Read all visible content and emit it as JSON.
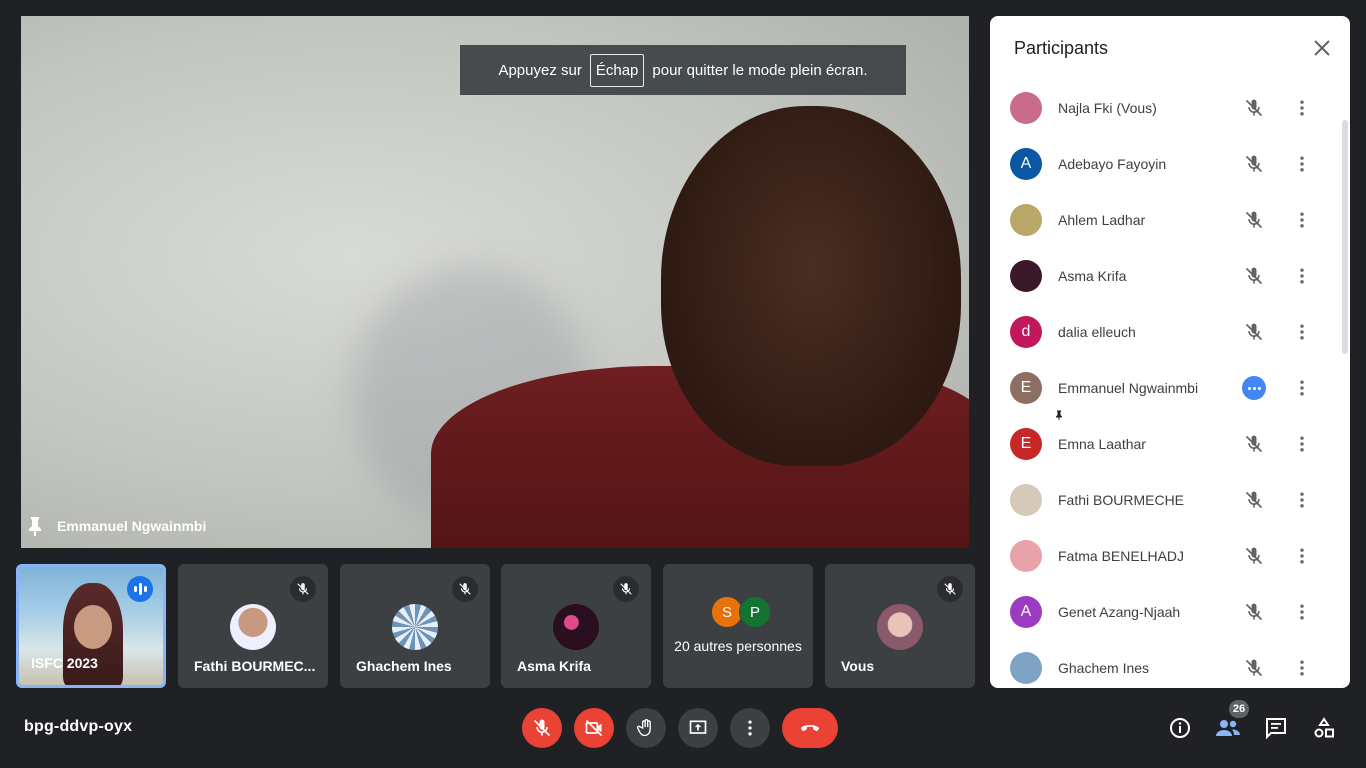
{
  "main_video": {
    "speaker_name": "Emmanuel Ngwainmbi",
    "banner": {
      "prefix": "Appuyez sur",
      "key": "Échap",
      "suffix": "pour quitter le mode plein écran."
    }
  },
  "tiles": [
    {
      "name": "ISFC 2023",
      "active": true
    },
    {
      "name": "Fathi BOURMEC..."
    },
    {
      "name": "Ghachem Ines"
    },
    {
      "name": "Asma Krifa"
    },
    {
      "name": "20 autres personnes",
      "avatars": [
        "S",
        "P"
      ]
    },
    {
      "name": "Vous"
    }
  ],
  "meeting_code": "bpg-ddvp-oyx",
  "participant_count": "26",
  "panel": {
    "title": "Participants",
    "participants": [
      {
        "name": "Najla Fki (Vous)",
        "initial": "",
        "color": "#c96b8a"
      },
      {
        "name": "Adebayo Fayoyin",
        "initial": "A",
        "color": "#0b57a4"
      },
      {
        "name": "Ahlem Ladhar",
        "initial": "",
        "color": "#b9a76a"
      },
      {
        "name": "Asma Krifa",
        "initial": "",
        "color": "#3a1a2a"
      },
      {
        "name": "dalia elleuch",
        "initial": "d",
        "color": "#c2185b"
      },
      {
        "name": "Emmanuel Ngwainmbi",
        "initial": "E",
        "color": "#8d6e63"
      },
      {
        "name": "Emna Laathar",
        "initial": "E",
        "color": "#c62828"
      },
      {
        "name": "Fathi BOURMECHE",
        "initial": "",
        "color": "#d7c9b8"
      },
      {
        "name": "Fatma BENELHADJ",
        "initial": "",
        "color": "#e7a3a8"
      },
      {
        "name": "Genet Azang-Njaah",
        "initial": "A",
        "color": "#9c3bc2"
      },
      {
        "name": "Ghachem Ines",
        "initial": "",
        "color": "#7fa3c4"
      }
    ]
  }
}
